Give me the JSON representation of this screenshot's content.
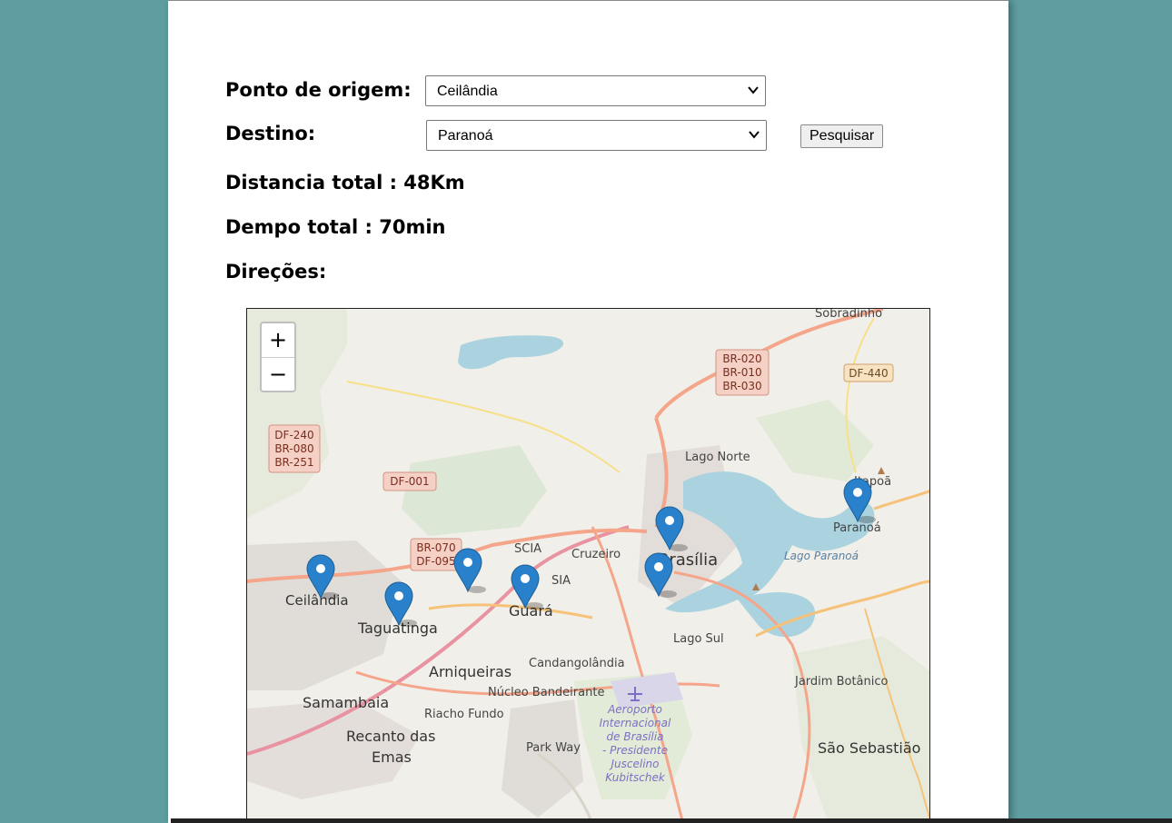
{
  "form": {
    "origin_label": "Ponto de origem:",
    "origin_value": "Ceilândia",
    "destination_label": "Destino:",
    "destination_value": "Paranoá",
    "search_button": "Pesquisar"
  },
  "summary": {
    "distance": "Distancia total : 48Km",
    "time": "Dempo total : 70min",
    "directions": "Direções:"
  },
  "map": {
    "zoom_in": "+",
    "zoom_out": "−",
    "places": {
      "sobradinho": "Sobradinho",
      "lago_norte": "Lago Norte",
      "itapoa": "Itapoã",
      "paranoa": "Paranoá",
      "lago_paranoa": "Lago Paranoá",
      "brasilia": "Brasília",
      "cruzeiro": "Cruzeiro",
      "scia": "SCIA",
      "sia": "SIA",
      "guara": "Guará",
      "ceilandia": "Ceilândia",
      "taguatinga": "Taguatinga",
      "arniqueiras": "Arniqueiras",
      "candangolandia": "Candangolândia",
      "lago_sul": "Lago Sul",
      "jardim_botanico": "Jardim Botânico",
      "nucleo_bandeirante": "Núcleo Bandeirante",
      "samambaia": "Samambaia",
      "riacho_fundo": "Riacho Fundo",
      "recanto_1": "Recanto das",
      "recanto_2": "Emas",
      "park_way": "Park Way",
      "sao_sebastiao": "São Sebastião",
      "airport_1": "Aeroporto",
      "airport_2": "Internacional",
      "airport_3": "de Brasília",
      "airport_4": "- Presidente",
      "airport_5": "Juscelino",
      "airport_6": "Kubitschek"
    },
    "shields": {
      "br020": "BR-020",
      "br010": "BR-010",
      "br030": "BR-030",
      "df440": "DF-440",
      "df240": "DF-240",
      "br080": "BR-080",
      "br251": "BR-251",
      "df001": "DF-001",
      "br070": "BR-070",
      "df095": "DF-095"
    },
    "marker_color": "#2a81cb"
  }
}
